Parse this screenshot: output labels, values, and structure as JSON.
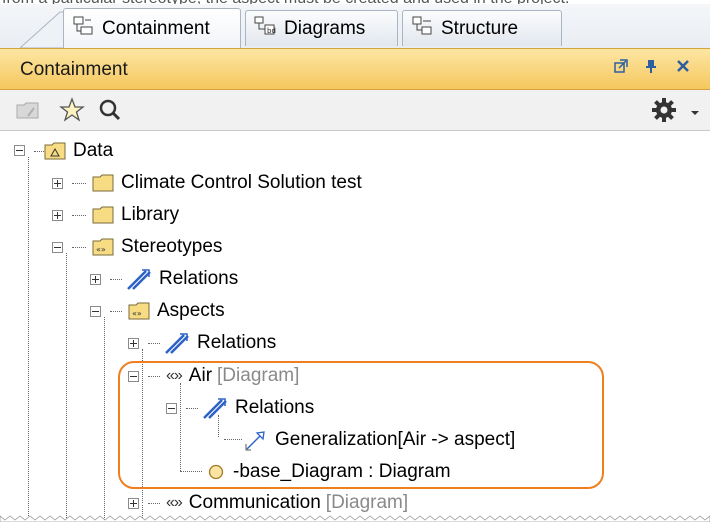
{
  "top_caption": "from a particular stereotype, the aspect must be created and used in the project.",
  "tabs": [
    {
      "label": "Containment",
      "icon": "containment-tree-icon",
      "active": true
    },
    {
      "label": "Diagrams",
      "icon": "diagrams-icon",
      "active": false
    },
    {
      "label": "Structure",
      "icon": "structure-icon",
      "active": false
    }
  ],
  "panel": {
    "title": "Containment",
    "header_buttons": [
      "restore-icon",
      "pin-icon",
      "close-icon"
    ]
  },
  "toolbar": {
    "icons": [
      "collapse-all-icon",
      "favorites-star-icon",
      "search-icon",
      "settings-gear-icon",
      "dropdown-arrow-icon"
    ]
  },
  "tree": {
    "data": "Data",
    "climate": "Climate Control Solution test",
    "library": "Library",
    "stereotypes": "Stereotypes",
    "relations1": "Relations",
    "aspects": "Aspects",
    "relations2": "Relations",
    "air": "Air",
    "air_type": "[Diagram]",
    "relations3": "Relations",
    "generalization": "Generalization[Air -> aspect]",
    "base_diagram": "-base_Diagram : Diagram",
    "communication": "Communication",
    "communication_type": "[Diagram]",
    "stereo_marker": "«»"
  },
  "colors": {
    "panel_header": "#f5c75e",
    "highlight": "#f07f20",
    "relation_icon": "#2d63c6",
    "folder": "#f7dc84"
  }
}
